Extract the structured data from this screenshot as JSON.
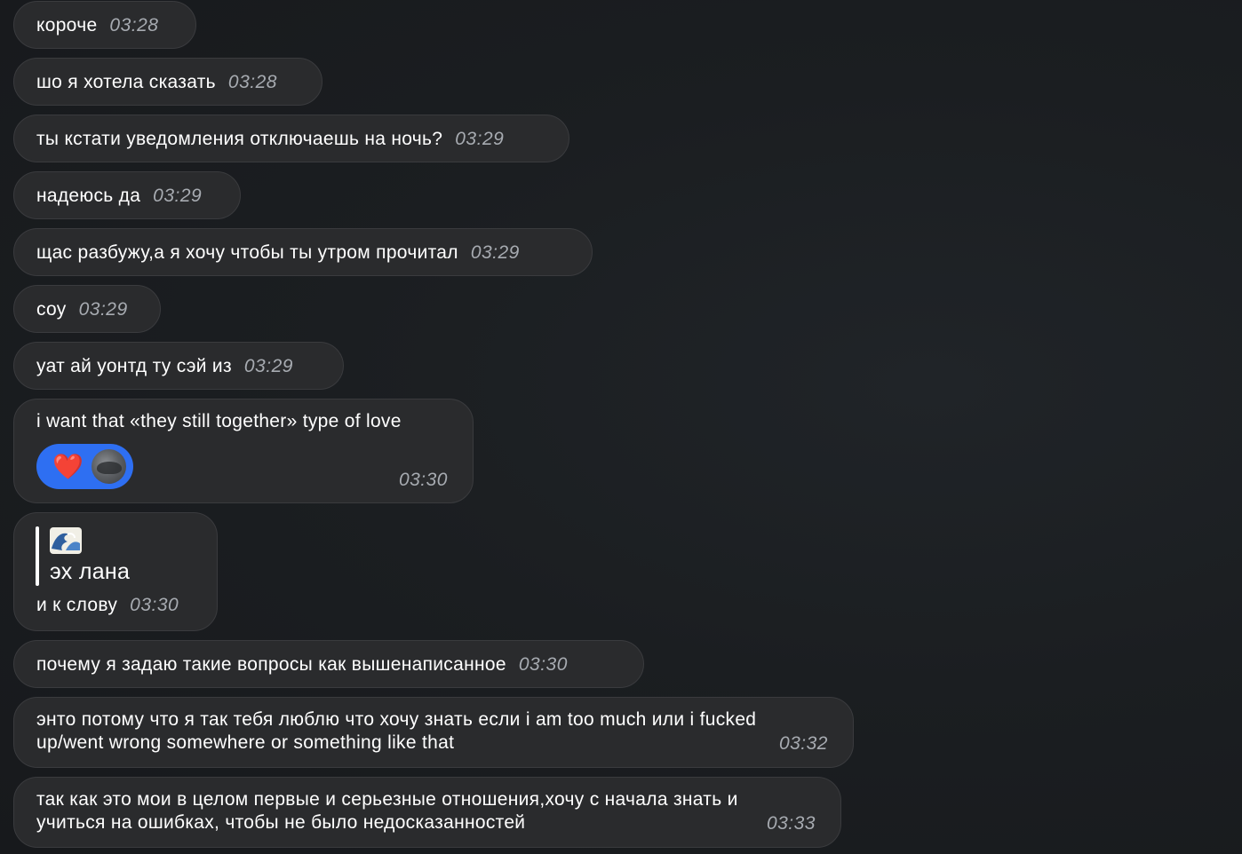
{
  "messages": [
    {
      "text": "короче",
      "time": "03:28"
    },
    {
      "text": "шо я хотела сказать",
      "time": "03:28"
    },
    {
      "text": "ты кстати уведомления отключаешь на ночь?",
      "time": "03:29"
    },
    {
      "text": "надеюсь да",
      "time": "03:29"
    },
    {
      "text": "щас разбужу,а я хочу чтобы ты утром прочитал",
      "time": "03:29"
    },
    {
      "text": "соу",
      "time": "03:29"
    },
    {
      "text": "уат ай уонтд ту сэй из",
      "time": "03:29"
    },
    {
      "text": "i want that «they still together» type of love",
      "time": "03:30",
      "reaction": {
        "emoji": "❤️",
        "icon": "heart-icon"
      }
    },
    {
      "text": "и к слову",
      "time": "03:30",
      "quote": {
        "emoji": "🌊",
        "text": "эх лана"
      }
    },
    {
      "text": "почему я задаю такие вопросы как вышенаписанное",
      "time": "03:30"
    },
    {
      "line1": "энто потому что я так тебя люблю что хочу знать если i am too much или i fucked",
      "line2": "up/went wrong somewhere or something like that",
      "time": "03:32"
    },
    {
      "line1": "так как это мои  в целом первые и серьезные отношения,хочу с начала знать и",
      "line2": "учиться на ошибках, чтобы не было недосказанностей",
      "time": "03:33"
    }
  ],
  "colors": {
    "bubble": "#2a2b2d",
    "timestamp": "#a7abb1",
    "reaction": "#2e6ff2",
    "heart": "#e8263a"
  }
}
